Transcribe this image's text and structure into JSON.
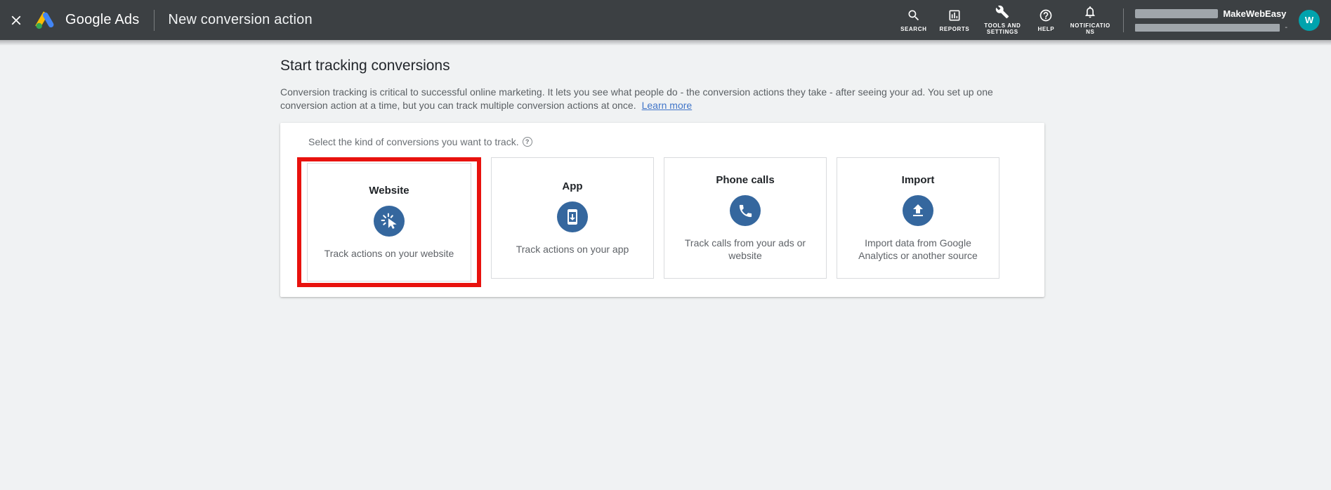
{
  "header": {
    "brand": "Google Ads",
    "page_title": "New conversion action",
    "nav": [
      {
        "label": "SEARCH",
        "icon": "search-icon"
      },
      {
        "label": "REPORTS",
        "icon": "reports-icon"
      },
      {
        "label": "TOOLS AND SETTINGS",
        "icon": "wrench-icon"
      },
      {
        "label": "HELP",
        "icon": "help-icon"
      },
      {
        "label": "NOTIFICATIONS",
        "icon": "bell-icon"
      }
    ],
    "account": {
      "name": "MakeWebEasy",
      "id_suffix": "-",
      "avatar_initial": "W"
    }
  },
  "main": {
    "heading": "Start tracking conversions",
    "description_line1": "Conversion tracking is critical to successful online marketing. It lets you see what people do - the conversion actions they take - after seeing your ad. You set up one",
    "description_line2": "conversion action at a time, but you can track multiple conversion actions at once.",
    "learn_more_label": "Learn more",
    "panel": {
      "prompt": "Select the kind of conversions you want to track.",
      "help_glyph": "?",
      "cards": [
        {
          "title": "Website",
          "subtitle": "Track actions on your website",
          "icon": "website-click-icon",
          "highlighted": true
        },
        {
          "title": "App",
          "subtitle": "Track actions on your app",
          "icon": "app-phone-icon",
          "highlighted": false
        },
        {
          "title": "Phone calls",
          "subtitle": "Track calls from your ads or website",
          "icon": "phone-call-icon",
          "highlighted": false
        },
        {
          "title": "Import",
          "subtitle": "Import data from Google Analytics or another source",
          "icon": "import-upload-icon",
          "highlighted": false
        }
      ]
    }
  },
  "colors": {
    "header_bg": "#3c4043",
    "icon_circle_blue": "#35679e",
    "highlight_red": "#e8120e",
    "link_blue": "#4175c8",
    "avatar_teal": "#00a3ad"
  }
}
